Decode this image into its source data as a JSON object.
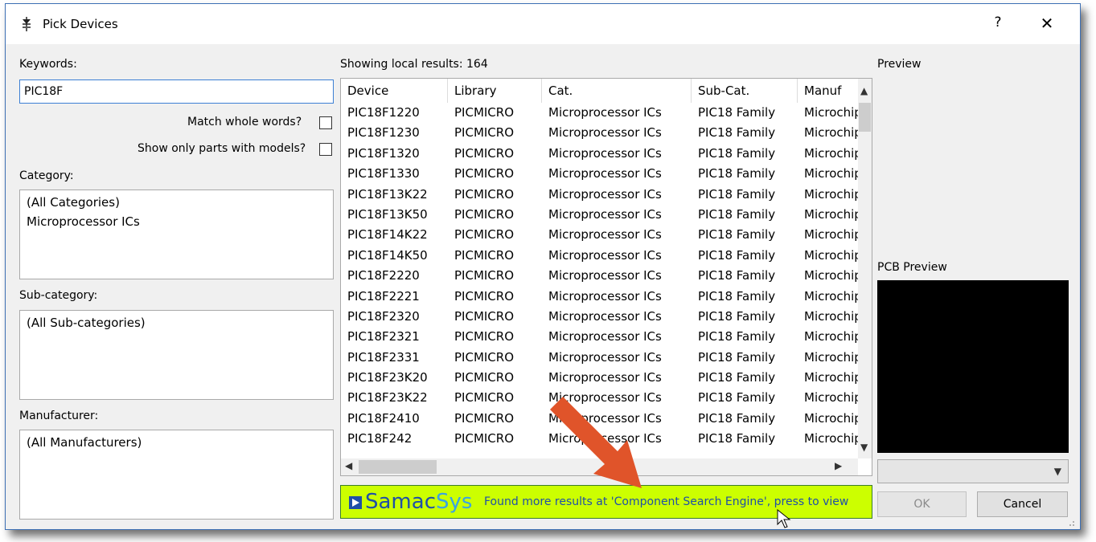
{
  "window": {
    "title": "Pick Devices",
    "help_label": "?",
    "close_label": "✕"
  },
  "left": {
    "keywords_label": "Keywords:",
    "keywords_value": "PIC18F",
    "match_whole_label": "Match whole words?",
    "match_whole_checked": false,
    "show_models_label": "Show only parts with models?",
    "show_models_checked": false,
    "category_label": "Category:",
    "categories": [
      "(All Categories)",
      "Microprocessor ICs"
    ],
    "subcategory_label": "Sub-category:",
    "subcategories": [
      "(All Sub-categories)"
    ],
    "manufacturer_label": "Manufacturer:",
    "manufacturers": [
      "(All Manufacturers)"
    ]
  },
  "results": {
    "count_label": "Showing local results: 164",
    "columns": [
      "Device",
      "Library",
      "Cat.",
      "Sub-Cat.",
      "Manuf"
    ],
    "rows": [
      [
        "PIC18F1220",
        "PICMICRO",
        "Microprocessor ICs",
        "PIC18 Family",
        "Microchip"
      ],
      [
        "PIC18F1230",
        "PICMICRO",
        "Microprocessor ICs",
        "PIC18 Family",
        "Microchip"
      ],
      [
        "PIC18F1320",
        "PICMICRO",
        "Microprocessor ICs",
        "PIC18 Family",
        "Microchip"
      ],
      [
        "PIC18F1330",
        "PICMICRO",
        "Microprocessor ICs",
        "PIC18 Family",
        "Microchip"
      ],
      [
        "PIC18F13K22",
        "PICMICRO",
        "Microprocessor ICs",
        "PIC18 Family",
        "Microchip"
      ],
      [
        "PIC18F13K50",
        "PICMICRO",
        "Microprocessor ICs",
        "PIC18 Family",
        "Microchip"
      ],
      [
        "PIC18F14K22",
        "PICMICRO",
        "Microprocessor ICs",
        "PIC18 Family",
        "Microchip"
      ],
      [
        "PIC18F14K50",
        "PICMICRO",
        "Microprocessor ICs",
        "PIC18 Family",
        "Microchip"
      ],
      [
        "PIC18F2220",
        "PICMICRO",
        "Microprocessor ICs",
        "PIC18 Family",
        "Microchip"
      ],
      [
        "PIC18F2221",
        "PICMICRO",
        "Microprocessor ICs",
        "PIC18 Family",
        "Microchip"
      ],
      [
        "PIC18F2320",
        "PICMICRO",
        "Microprocessor ICs",
        "PIC18 Family",
        "Microchip"
      ],
      [
        "PIC18F2321",
        "PICMICRO",
        "Microprocessor ICs",
        "PIC18 Family",
        "Microchip"
      ],
      [
        "PIC18F2331",
        "PICMICRO",
        "Microprocessor ICs",
        "PIC18 Family",
        "Microchip"
      ],
      [
        "PIC18F23K20",
        "PICMICRO",
        "Microprocessor ICs",
        "PIC18 Family",
        "Microchip"
      ],
      [
        "PIC18F23K22",
        "PICMICRO",
        "Microprocessor ICs",
        "PIC18 Family",
        "Microchip"
      ],
      [
        "PIC18F2410",
        "PICMICRO",
        "Microprocessor ICs",
        "PIC18 Family",
        "Microchip"
      ],
      [
        "PIC18F242",
        "PICMICRO",
        "Microprocessor ICs",
        "PIC18 Family",
        "Microchip"
      ]
    ]
  },
  "banner": {
    "logo_samac": "Samac",
    "logo_sys": "Sys",
    "text": "Found more results at 'Component Search Engine', press to view"
  },
  "preview": {
    "preview_label": "Preview",
    "pcb_label": "PCB Preview"
  },
  "buttons": {
    "ok": "OK",
    "cancel": "Cancel"
  },
  "colors": {
    "banner_bg": "#ccff00",
    "accent": "#1f4fa8",
    "overlay_arrow": "#e0542a"
  },
  "icons": {
    "title": "component-icon",
    "overlay": "annotation-arrow-icon",
    "cursor": "mouse-pointer-icon"
  }
}
